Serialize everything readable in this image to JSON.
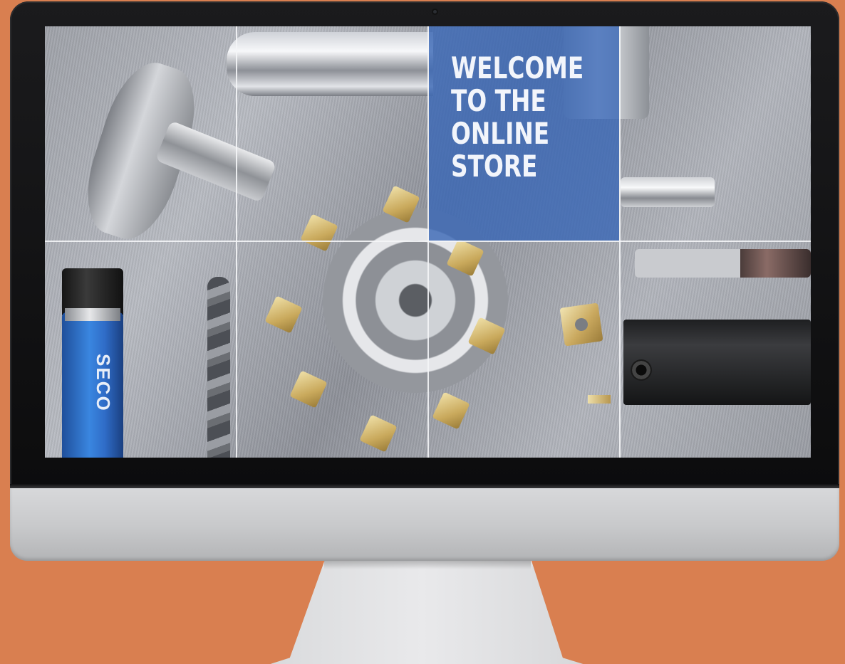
{
  "screen": {
    "hero_text": "WELCOME\nTO THE\nONLINE\nSTORE",
    "brand_logo_text": "SECO",
    "accent_color": "#3a68b6",
    "background_color": "#d97f50"
  }
}
